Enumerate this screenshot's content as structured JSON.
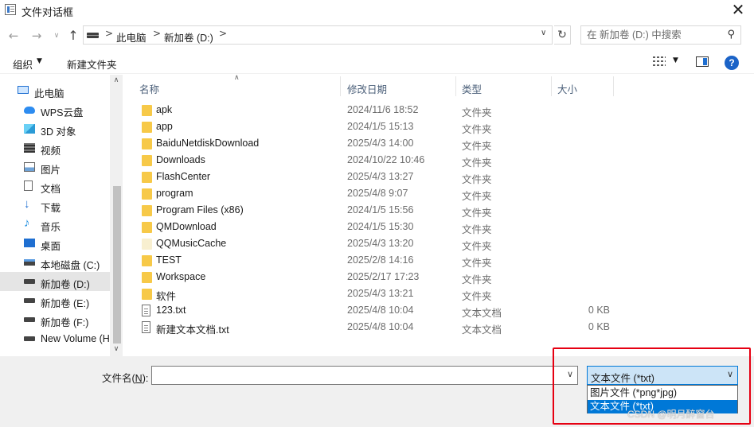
{
  "window": {
    "title": "文件对话框",
    "close_label": "✕"
  },
  "nav": {
    "back": "←",
    "forward": "→",
    "recent": "∨",
    "up": "↑",
    "breadcrumb": [
      "此电脑",
      "新加卷 (D:)"
    ],
    "crumb_separator": ">",
    "refresh": "↻",
    "search_placeholder": "在 新加卷 (D:) 中搜索"
  },
  "toolbar": {
    "organize_label": "组织",
    "new_folder_label": "新建文件夹"
  },
  "sidebar": {
    "items": [
      {
        "label": "此电脑",
        "icon": "computer-icon",
        "selected": false
      },
      {
        "label": "WPS云盘",
        "icon": "cloud-icon",
        "selected": false
      },
      {
        "label": "3D 对象",
        "icon": "cube-icon",
        "selected": false
      },
      {
        "label": "视频",
        "icon": "video-icon",
        "selected": false
      },
      {
        "label": "图片",
        "icon": "picture-icon",
        "selected": false
      },
      {
        "label": "文档",
        "icon": "document-icon",
        "selected": false
      },
      {
        "label": "下载",
        "icon": "download-icon",
        "selected": false
      },
      {
        "label": "音乐",
        "icon": "music-icon",
        "selected": false
      },
      {
        "label": "桌面",
        "icon": "desktop-icon",
        "selected": false
      },
      {
        "label": "本地磁盘 (C:)",
        "icon": "system-drive-icon",
        "selected": false
      },
      {
        "label": "新加卷 (D:)",
        "icon": "drive-icon",
        "selected": true
      },
      {
        "label": "新加卷 (E:)",
        "icon": "drive-icon",
        "selected": false
      },
      {
        "label": "新加卷 (F:)",
        "icon": "drive-icon",
        "selected": false
      },
      {
        "label": "New Volume (H",
        "icon": "drive-icon",
        "selected": false
      }
    ]
  },
  "files": {
    "columns": {
      "name": "名称",
      "date": "修改日期",
      "type": "类型",
      "size": "大小"
    },
    "rows": [
      {
        "name": "apk",
        "date": "2024/11/6 18:52",
        "type": "文件夹",
        "size": "",
        "kind": "folder"
      },
      {
        "name": "app",
        "date": "2024/1/5 15:13",
        "type": "文件夹",
        "size": "",
        "kind": "folder"
      },
      {
        "name": "BaiduNetdiskDownload",
        "date": "2025/4/3 14:00",
        "type": "文件夹",
        "size": "",
        "kind": "folder"
      },
      {
        "name": "Downloads",
        "date": "2024/10/22 10:46",
        "type": "文件夹",
        "size": "",
        "kind": "folder"
      },
      {
        "name": "FlashCenter",
        "date": "2025/4/3 13:27",
        "type": "文件夹",
        "size": "",
        "kind": "folder"
      },
      {
        "name": "program",
        "date": "2025/4/8 9:07",
        "type": "文件夹",
        "size": "",
        "kind": "folder"
      },
      {
        "name": "Program Files (x86)",
        "date": "2024/1/5 15:56",
        "type": "文件夹",
        "size": "",
        "kind": "folder"
      },
      {
        "name": "QMDownload",
        "date": "2024/1/5 15:30",
        "type": "文件夹",
        "size": "",
        "kind": "folder"
      },
      {
        "name": "QQMusicCache",
        "date": "2025/4/3 13:20",
        "type": "文件夹",
        "size": "",
        "kind": "folder-hidden"
      },
      {
        "name": "TEST",
        "date": "2025/2/8 14:16",
        "type": "文件夹",
        "size": "",
        "kind": "folder"
      },
      {
        "name": "Workspace",
        "date": "2025/2/17 17:23",
        "type": "文件夹",
        "size": "",
        "kind": "folder"
      },
      {
        "name": "软件",
        "date": "2025/4/3 13:21",
        "type": "文件夹",
        "size": "",
        "kind": "folder"
      },
      {
        "name": "123.txt",
        "date": "2025/4/8 10:04",
        "type": "文本文档",
        "size": "0 KB",
        "kind": "text"
      },
      {
        "name": "新建文本文档.txt",
        "date": "2025/4/8 10:04",
        "type": "文本文档",
        "size": "0 KB",
        "kind": "text"
      }
    ]
  },
  "bottom": {
    "filename_label_prefix": "文件名(",
    "filename_label_key": "N",
    "filename_label_suffix": "):",
    "filename_value": "",
    "filetype_selected": "文本文件 (*txt)",
    "filetype_options": [
      "图片文件 (*png*jpg)",
      "文本文件 (*txt)"
    ],
    "highlighted_option_index": 1
  },
  "watermark": "CSDN @明月醉窗台",
  "colors": {
    "accent": "#0078d7",
    "folder": "#f7c948",
    "folder_hidden": "#f8efd0",
    "selection": "#cce4f7",
    "highlight_box": "#e60012"
  }
}
